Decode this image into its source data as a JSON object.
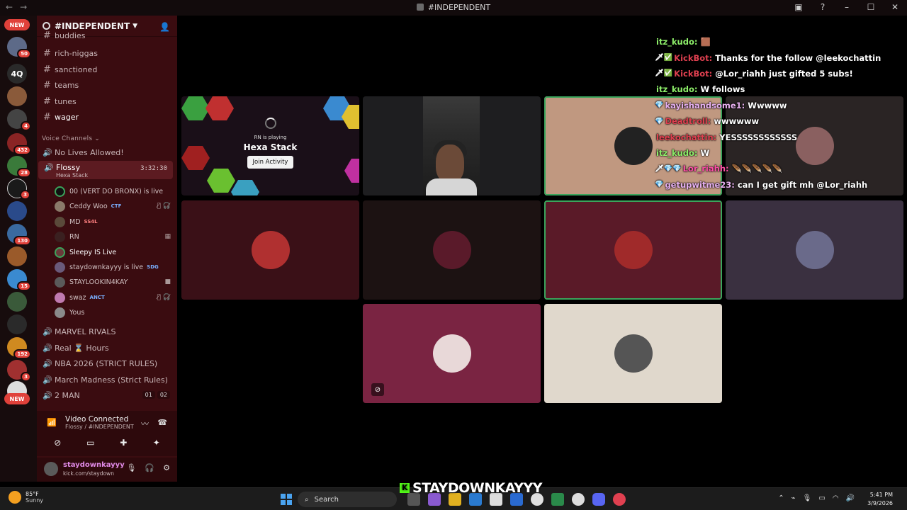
{
  "window": {
    "title": "#INDEPENDENT",
    "nav_back": "←",
    "nav_forward": "→"
  },
  "server_rail": {
    "new_label": "NEW",
    "new_label_bottom": "NEW",
    "badges": [
      "50",
      "4",
      "432",
      "28",
      "3",
      "130",
      "15",
      "192",
      "3"
    ],
    "short_server": "4Q"
  },
  "server": {
    "name": "#INDEPENDENT"
  },
  "text_channels": [
    {
      "name": "buddies"
    },
    {
      "name": "rich-niggas"
    },
    {
      "name": "sanctioned"
    },
    {
      "name": "teams"
    },
    {
      "name": "tunes"
    },
    {
      "name": "wager"
    }
  ],
  "voice_section_title": "Voice Channels",
  "voice_channels": {
    "first": "No Lives Allowed!",
    "active": {
      "name": "Flossy",
      "activity": "Hexa Stack",
      "timer": "3:32:30"
    },
    "users": [
      {
        "name": "00 (VERT DO BRONX) is live",
        "tag": ""
      },
      {
        "name": "Ceddy Woo",
        "tag": "CTF"
      },
      {
        "name": "MD",
        "tag": "SS4L"
      },
      {
        "name": "RN",
        "tag": ""
      },
      {
        "name": "Sleepy IS Live",
        "tag": ""
      },
      {
        "name": "staydownkayyy is live",
        "tag": "SDG"
      },
      {
        "name": "STAYLOOKIN4KAY",
        "tag": ""
      },
      {
        "name": "swaz",
        "tag": "ANCT"
      },
      {
        "name": "Yous",
        "tag": ""
      }
    ],
    "rest": [
      {
        "name": "MARVEL RIVALS"
      },
      {
        "name": "Real",
        "suffix": "Hours"
      },
      {
        "name": "NBA 2026 (STRICT RULES)"
      },
      {
        "name": "March Madness (Strict Rules)"
      },
      {
        "name": "2 MAN",
        "counts": [
          "01",
          "02"
        ]
      }
    ]
  },
  "voice_panel": {
    "status": "Video Connected",
    "location": "Flossy / #INDEPENDENT"
  },
  "user_panel": {
    "display_name": "staydownkayyy",
    "status_text": "kick.com/staydown"
  },
  "activity": {
    "subtitle": "RN is playing",
    "game": "Hexa Stack",
    "join_label": "Join Activity"
  },
  "chat": [
    {
      "name": "itz_kudo:",
      "text": "🟫",
      "color": "#8ef06a",
      "badges": ""
    },
    {
      "name": "KickBot:",
      "text": "Thanks for the follow @leekochattin",
      "color": "#e04050",
      "badges": "🗡✅"
    },
    {
      "name": "KickBot:",
      "text": "@Lor_riahh just gifted 5 subs!",
      "color": "#e04050",
      "badges": "🗡✅"
    },
    {
      "name": "itz_kudo:",
      "text": "W follows",
      "color": "#8ef06a",
      "badges": ""
    },
    {
      "name": "kayishandsome1:",
      "text": "Wwwww",
      "color": "#e7b0f0",
      "badges": "💎"
    },
    {
      "name": "Deadtroll:",
      "text": "wwwwww",
      "color": "#e04050",
      "badges": "💎"
    },
    {
      "name": "leekochattin:",
      "text": "YESSSSSSSSSSSS",
      "color": "#e04050",
      "badges": ""
    },
    {
      "name": "itz_kudo:",
      "text": "W",
      "color": "#8ef06a",
      "badges": ""
    },
    {
      "name": "Lor_riahh:",
      "text": "🪶🪶🪶🪶🪶",
      "color": "#ff4fa8",
      "badges": "🗡💎💎"
    },
    {
      "name": "getupwitme23:",
      "text": "can I get gift mh @Lor_riahh",
      "color": "#e7b0f0",
      "badges": "💎"
    }
  ],
  "overlay": {
    "kick_logo": "K",
    "streamer": "STAYDOWNKAYYY"
  },
  "taskbar": {
    "temp": "85°F",
    "condition": "Sunny",
    "search_placeholder": "Search",
    "time": "5:41 PM",
    "date": "3/9/2026"
  }
}
